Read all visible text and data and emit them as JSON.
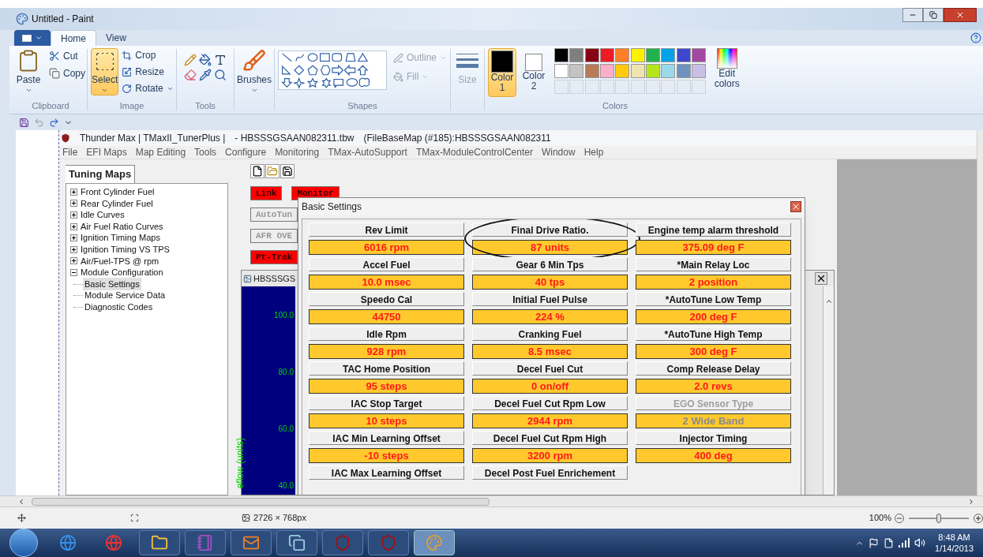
{
  "window": {
    "title": "Untitled - Paint"
  },
  "ribbon_tabs": [
    {
      "label": "Home",
      "selected": true
    },
    {
      "label": "View",
      "selected": false
    }
  ],
  "clipboard": {
    "title": "Clipboard",
    "paste": "Paste",
    "cut": "Cut",
    "copy": "Copy"
  },
  "image": {
    "title": "Image",
    "select": {
      "label": "Select",
      "selected": true
    },
    "crop": "Crop",
    "resize": "Resize",
    "rotate": "Rotate"
  },
  "tools": {
    "title": "Tools"
  },
  "brushes": {
    "label": "Brushes"
  },
  "shapes": {
    "title": "Shapes",
    "outline": {
      "label": "Outline",
      "disabled": true
    },
    "fill": {
      "label": "Fill",
      "disabled": true
    }
  },
  "size": {
    "label": "Size",
    "disabled": true
  },
  "colors": {
    "title": "Colors",
    "edit": "Edit colors",
    "slots": [
      {
        "label": "Color 1",
        "color": "#000000",
        "selected": true
      },
      {
        "label": "Color 2",
        "color": "#ffffff",
        "selected": false
      }
    ],
    "palette": [
      {
        "color": "#000000"
      },
      {
        "color": "#7f7f7f"
      },
      {
        "color": "#880015"
      },
      {
        "color": "#ed1c24"
      },
      {
        "color": "#ff7f27"
      },
      {
        "color": "#fff200"
      },
      {
        "color": "#22b14c"
      },
      {
        "color": "#00a2e8"
      },
      {
        "color": "#3f48cc"
      },
      {
        "color": "#a349a4"
      },
      {
        "color": "#ffffff"
      },
      {
        "color": "#c3c3c3"
      },
      {
        "color": "#b97a57"
      },
      {
        "color": "#ffaec9"
      },
      {
        "color": "#ffc90e"
      },
      {
        "color": "#efe4b0"
      },
      {
        "color": "#b5e61d"
      },
      {
        "color": "#99d9ea"
      },
      {
        "color": "#7092be"
      },
      {
        "color": "#c8bfe7"
      },
      {
        "kind": "empty"
      },
      {
        "kind": "empty"
      },
      {
        "kind": "empty"
      },
      {
        "kind": "empty"
      },
      {
        "kind": "empty"
      },
      {
        "kind": "empty"
      },
      {
        "kind": "empty"
      },
      {
        "kind": "empty"
      },
      {
        "kind": "empty"
      },
      {
        "kind": "empty"
      }
    ]
  },
  "app": {
    "title_parts": [
      "Thunder Max | TMaxII_TunerPlus |",
      "- HBSSSGSAAN082311.tbw",
      "(FileBaseMap (#185):HBSSSGSAAN082311"
    ],
    "menu": [
      "File",
      "EFI Maps",
      "Map Editing",
      "Tools",
      "Configure",
      "Monitoring",
      "TMax-AutoSupport",
      "TMax-ModuleControlCenter",
      "Window",
      "Help"
    ],
    "panel_tab": "Tuning Maps",
    "tree": [
      {
        "label": "Front Cylinder Fuel",
        "expanded": false,
        "selected": false
      },
      {
        "label": "Rear Cylinder Fuel",
        "expanded": false,
        "selected": false
      },
      {
        "label": "Idle Curves",
        "expanded": false,
        "selected": false
      },
      {
        "label": "Air Fuel Ratio Curves",
        "expanded": false,
        "selected": false
      },
      {
        "label": "Ignition Timing Maps",
        "expanded": false,
        "selected": false
      },
      {
        "label": "Ignition Timing VS TPS",
        "expanded": false,
        "selected": false
      },
      {
        "label": "Air/Fuel-TPS @ rpm",
        "expanded": false,
        "selected": false
      },
      {
        "label": "Module Configuration",
        "expanded": true,
        "selected": false,
        "children": [
          {
            "label": "Basic Settings",
            "selected": true
          },
          {
            "label": "Module Service Data",
            "selected": false
          },
          {
            "label": "Diagnostic Codes",
            "selected": false
          }
        ]
      }
    ],
    "toolbar_buttons": [
      {
        "label": "Link",
        "active": true
      },
      {
        "label": "Monitor",
        "active": true
      },
      {
        "label": "AutoTun",
        "active": false
      },
      {
        "label": "AFR OVE",
        "active": false
      },
      {
        "label": "Pt-Trak",
        "active": true
      }
    ],
    "map_window": {
      "title": "HBSSSGS",
      "axis_label": "eflow (units)",
      "tick_labels": [
        "100.0",
        "80.0",
        "60.0",
        "40.0"
      ]
    },
    "dialog": {
      "title": "Basic Settings",
      "settings": [
        {
          "label": "Rev Limit",
          "value": "6016 rpm",
          "disabled": false,
          "circled": false
        },
        {
          "label": "Final Drive Ratio.",
          "value": "87 units",
          "disabled": false,
          "circled": true
        },
        {
          "label": "Engine temp alarm threshold",
          "value": "375.09 deg F",
          "disabled": false,
          "circled": false
        },
        {
          "label": "Accel Fuel",
          "value": "10.0 msec",
          "disabled": false,
          "circled": false
        },
        {
          "label": "Gear 6 Min Tps",
          "value": "40 tps",
          "disabled": false,
          "circled": false
        },
        {
          "label": "*Main Relay Loc",
          "value": "2 position",
          "disabled": false,
          "circled": false
        },
        {
          "label": "Speedo Cal",
          "value": "44750",
          "disabled": false,
          "circled": false
        },
        {
          "label": "Initial Fuel Pulse",
          "value": "224 %",
          "disabled": false,
          "circled": false
        },
        {
          "label": "*AutoTune Low Temp",
          "value": "200 deg F",
          "disabled": false,
          "circled": false
        },
        {
          "label": "Idle Rpm",
          "value": "928 rpm",
          "disabled": false,
          "circled": false
        },
        {
          "label": "Cranking Fuel",
          "value": "8.5 msec",
          "disabled": false,
          "circled": false
        },
        {
          "label": "*AutoTune High Temp",
          "value": "300 deg F",
          "disabled": false,
          "circled": false
        },
        {
          "label": "TAC Home Position",
          "value": "95 steps",
          "disabled": false,
          "circled": false
        },
        {
          "label": "Decel Fuel Cut",
          "value": "0 on/off",
          "disabled": false,
          "circled": false
        },
        {
          "label": "Comp Release Delay",
          "value": "2.0 revs",
          "disabled": false,
          "circled": false
        },
        {
          "label": "IAC Stop Target",
          "value": "10 steps",
          "disabled": false,
          "circled": false
        },
        {
          "label": "Decel Fuel Cut Rpm Low",
          "value": "2944 rpm",
          "disabled": false,
          "circled": false
        },
        {
          "label": "EGO Sensor Type",
          "value": "2 Wide Band",
          "disabled": true,
          "circled": false
        },
        {
          "label": "IAC Min Learning Offset",
          "value": "-10 steps",
          "disabled": false,
          "circled": false
        },
        {
          "label": "Decel Fuel Cut Rpm High",
          "value": "3200 rpm",
          "disabled": false,
          "circled": false
        },
        {
          "label": "Injector Timing",
          "value": "400 deg",
          "disabled": false,
          "circled": false
        },
        {
          "label": "IAC Max Learning Offset",
          "disabled": false,
          "circled": false
        },
        {
          "label": "Decel Post Fuel Enrichement",
          "disabled": false,
          "circled": false
        }
      ]
    }
  },
  "status_bar": {
    "image_size": "2726 × 768px",
    "zoom": "100%",
    "zoom_slider": {
      "level": 0.5
    }
  },
  "taskbar": {
    "time": "8:48 AM",
    "date": "1/14/2013"
  }
}
